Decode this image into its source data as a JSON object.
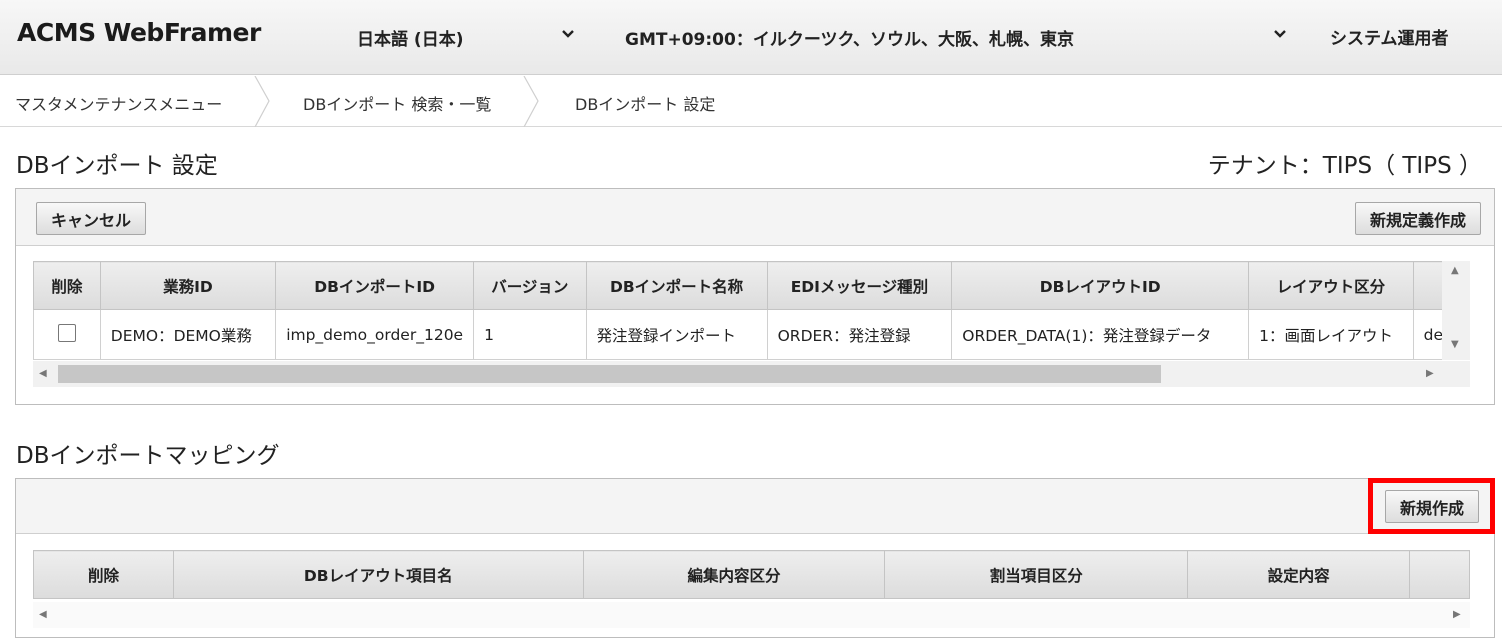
{
  "header": {
    "logo": "ACMS WebFramer",
    "language": "日本語 (日本)",
    "timezone": "GMT+09:00：イルクーツク、ソウル、大阪、札幌、東京",
    "user": "システム運用者"
  },
  "breadcrumb": [
    "マスタメンテナンスメニュー",
    "DBインポート 検索・一覧",
    "DBインポート 設定"
  ],
  "page": {
    "title": "DBインポート 設定",
    "tenant": "テナント：TIPS（ TIPS ）"
  },
  "toolbar": {
    "cancel_label": "キャンセル",
    "new_definition_label": "新規定義作成"
  },
  "import_table": {
    "columns": [
      "削除",
      "業務ID",
      "DBインポートID",
      "バージョン",
      "DBインポート名称",
      "EDIメッセージ種別",
      "DBレイアウトID",
      "レイアウト区分"
    ],
    "rows": [
      {
        "checked": false,
        "business_id": "DEMO：DEMO業務",
        "import_id": "imp_demo_order_120e",
        "version": "1",
        "import_name": "発注登録インポート",
        "edi_type": "ORDER：発注登録",
        "layout_id": "ORDER_DATA(1)：発注登録データ",
        "layout_kind": "1：画面レイアウト",
        "extra": "de"
      }
    ]
  },
  "mapping": {
    "title": "DBインポートマッピング",
    "new_label": "新規作成",
    "columns": [
      "削除",
      "DBレイアウト項目名",
      "編集内容区分",
      "割当項目区分",
      "設定内容"
    ]
  }
}
